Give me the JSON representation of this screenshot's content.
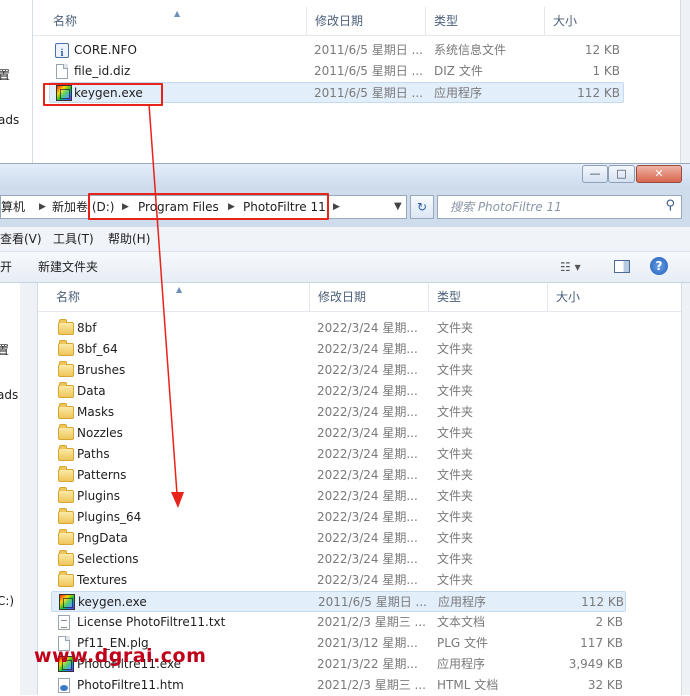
{
  "top_window": {
    "columns": {
      "name": "名称",
      "date": "修改日期",
      "type": "类型",
      "size": "大小"
    },
    "files": [
      {
        "name": "CORE.NFO",
        "date": "2011/6/5 星期日 ...",
        "type": "系统信息文件",
        "size": "12 KB",
        "icon": "nfo-icon"
      },
      {
        "name": "file_id.diz",
        "date": "2011/6/5 星期日 ...",
        "type": "DIZ 文件",
        "size": "1 KB",
        "icon": "document-icon"
      },
      {
        "name": "keygen.exe",
        "date": "2011/6/5 星期日 ...",
        "type": "应用程序",
        "size": "112 KB",
        "icon": "keygen-app-icon"
      }
    ],
    "clipped_nav": [
      "置",
      "ads"
    ]
  },
  "main_window": {
    "title_buttons": {
      "minimize": "—",
      "maximize": "□",
      "close": "✕"
    },
    "breadcrumb": {
      "computer": "算机",
      "drive": "新加卷 (D:)",
      "folder1": "Program Files",
      "folder2": "PhotoFiltre 11"
    },
    "search_placeholder": "搜索 PhotoFiltre 11",
    "menu": {
      "view": "查看(V)",
      "tools": "工具(T)",
      "help": "帮助(H)"
    },
    "toolbar": {
      "open_clipped": "开",
      "new_folder": "新建文件夹",
      "help": "?"
    },
    "columns": {
      "name": "名称",
      "date": "修改日期",
      "type": "类型",
      "size": "大小"
    },
    "clipped_nav": [
      "置",
      "ads",
      "C:)"
    ],
    "files": [
      {
        "name": "8bf",
        "date": "2022/3/24 星期...",
        "type": "文件夹",
        "size": "",
        "icon": "folder-icon"
      },
      {
        "name": "8bf_64",
        "date": "2022/3/24 星期...",
        "type": "文件夹",
        "size": "",
        "icon": "folder-icon"
      },
      {
        "name": "Brushes",
        "date": "2022/3/24 星期...",
        "type": "文件夹",
        "size": "",
        "icon": "folder-icon"
      },
      {
        "name": "Data",
        "date": "2022/3/24 星期...",
        "type": "文件夹",
        "size": "",
        "icon": "folder-icon"
      },
      {
        "name": "Masks",
        "date": "2022/3/24 星期...",
        "type": "文件夹",
        "size": "",
        "icon": "folder-icon"
      },
      {
        "name": "Nozzles",
        "date": "2022/3/24 星期...",
        "type": "文件夹",
        "size": "",
        "icon": "folder-icon"
      },
      {
        "name": "Paths",
        "date": "2022/3/24 星期...",
        "type": "文件夹",
        "size": "",
        "icon": "folder-icon"
      },
      {
        "name": "Patterns",
        "date": "2022/3/24 星期...",
        "type": "文件夹",
        "size": "",
        "icon": "folder-icon"
      },
      {
        "name": "Plugins",
        "date": "2022/3/24 星期...",
        "type": "文件夹",
        "size": "",
        "icon": "folder-icon"
      },
      {
        "name": "Plugins_64",
        "date": "2022/3/24 星期...",
        "type": "文件夹",
        "size": "",
        "icon": "folder-icon"
      },
      {
        "name": "PngData",
        "date": "2022/3/24 星期...",
        "type": "文件夹",
        "size": "",
        "icon": "folder-icon"
      },
      {
        "name": "Selections",
        "date": "2022/3/24 星期...",
        "type": "文件夹",
        "size": "",
        "icon": "folder-icon"
      },
      {
        "name": "Textures",
        "date": "2022/3/24 星期...",
        "type": "文件夹",
        "size": "",
        "icon": "folder-icon"
      },
      {
        "name": "keygen.exe",
        "date": "2011/6/5 星期日 ...",
        "type": "应用程序",
        "size": "112 KB",
        "icon": "keygen-app-icon"
      },
      {
        "name": "License PhotoFiltre11.txt",
        "date": "2021/2/3 星期三 ...",
        "type": "文本文档",
        "size": "2 KB",
        "icon": "text-file-icon"
      },
      {
        "name": "Pf11_EN.plg",
        "date": "2021/3/12 星期...",
        "type": "PLG 文件",
        "size": "117 KB",
        "icon": "document-icon"
      },
      {
        "name": "PhotoFiltre11.exe",
        "date": "2021/3/22 星期...",
        "type": "应用程序",
        "size": "3,949 KB",
        "icon": "photofiltre-app-icon"
      },
      {
        "name": "PhotoFiltre11.htm",
        "date": "2021/2/3 星期三 ...",
        "type": "HTML 文档",
        "size": "32 KB",
        "icon": "html-file-icon"
      }
    ]
  },
  "watermark": "www.dgrai.com",
  "colors": {
    "annotation_red": "#e8231a",
    "selection": "#e3eefb",
    "watermark": "#c0001a"
  }
}
